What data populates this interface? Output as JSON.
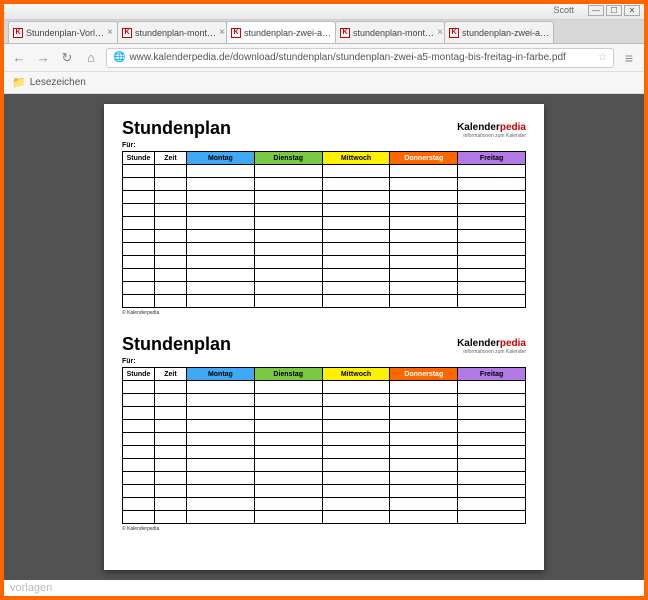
{
  "window": {
    "user": "Scott",
    "min": "—",
    "max": "☐",
    "close": "✕"
  },
  "tabs": [
    {
      "label": "Stundenplan-Vorl…"
    },
    {
      "label": "stundenplan-mont…"
    },
    {
      "label": "stundenplan-zwei-a…"
    },
    {
      "label": "stundenplan-mont…"
    },
    {
      "label": "stundenplan-zwei-a…"
    }
  ],
  "nav": {
    "back": "←",
    "fwd": "→",
    "reload": "↻",
    "home": "⌂",
    "globe": "🌐",
    "url": "www.kalenderpedia.de/download/stundenplan/stundenplan-zwei-a5-montag-bis-freitag-in-farbe.pdf",
    "star": "☆",
    "menu": "≡"
  },
  "bookmarks": {
    "folder_icon": "📁",
    "item": "Lesezeichen"
  },
  "doc": {
    "title": "Stundenplan",
    "brand_a": "Kalender",
    "brand_b": "pedia",
    "brand_sub": "Informationen zum Kalender",
    "fuer": "Für:",
    "headers": {
      "stunde": "Stunde",
      "zeit": "Zeit",
      "mon": "Montag",
      "tue": "Dienstag",
      "wed": "Mittwoch",
      "thu": "Donnerstag",
      "fri": "Freitag"
    },
    "colors": {
      "mon": "#3fa9f5",
      "tue": "#7ac943",
      "wed": "#fff200",
      "thu": "#ff6600",
      "fri": "#b27ae6"
    },
    "rows": 11,
    "copyright": "© Kalenderpedia"
  },
  "watermark": "vorlagen"
}
